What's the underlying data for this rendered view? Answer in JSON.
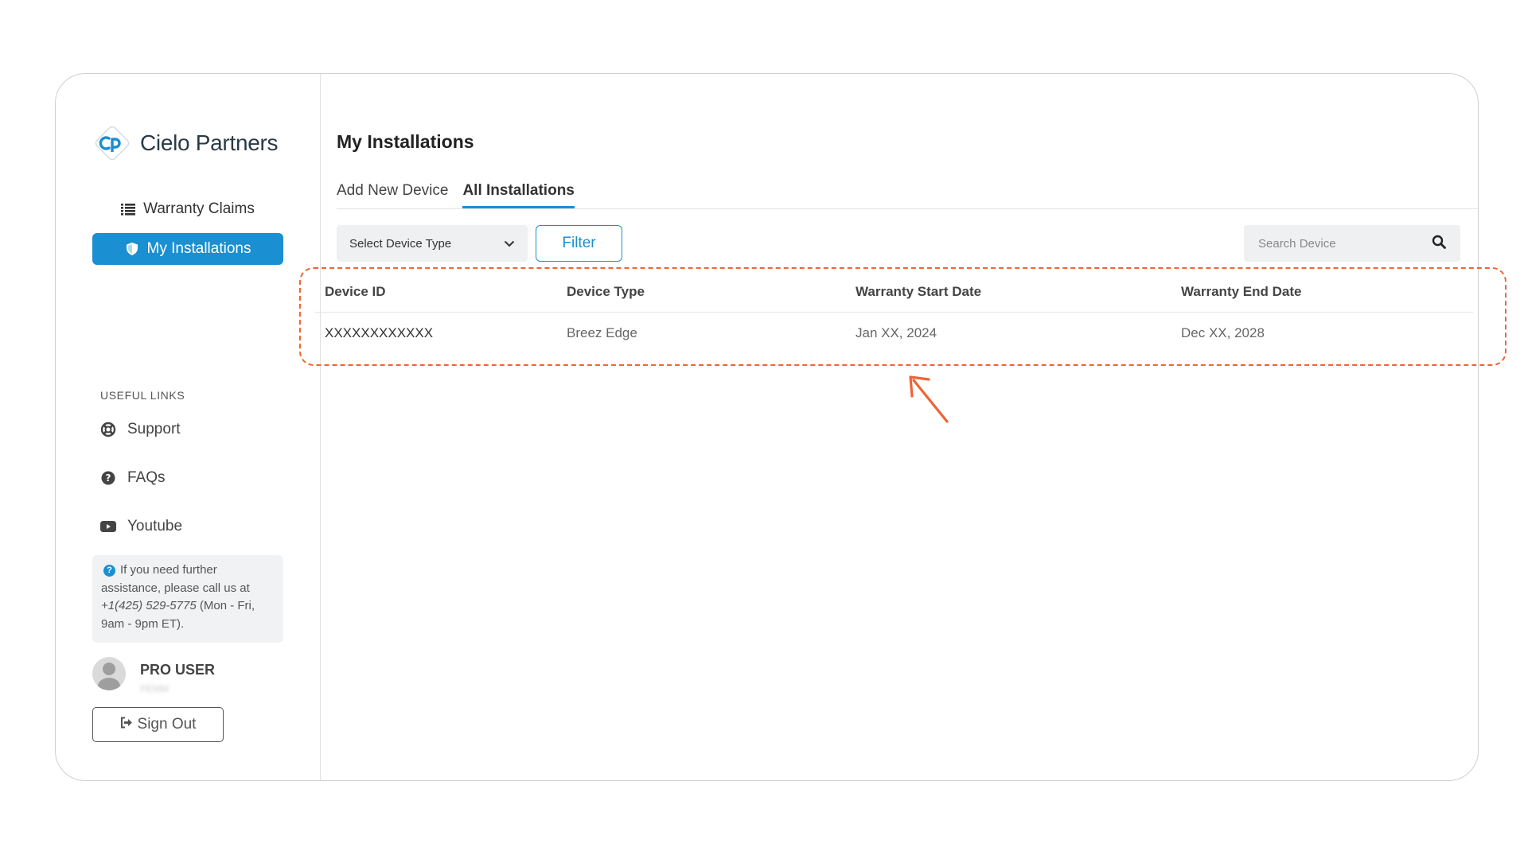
{
  "brand": {
    "name": "Cielo Partners",
    "mark": "cp",
    "color": "#1a8fd1"
  },
  "sidebar": {
    "nav": [
      {
        "label": "Warranty Claims",
        "icon": "list-icon",
        "active": false
      },
      {
        "label": "My Installations",
        "icon": "shield-icon",
        "active": true
      }
    ],
    "useful_links_title": "USEFUL LINKS",
    "links": [
      {
        "label": "Support",
        "icon": "lifebuoy-icon"
      },
      {
        "label": "FAQs",
        "icon": "question-circle-icon"
      },
      {
        "label": "Youtube",
        "icon": "youtube-icon"
      }
    ],
    "help": {
      "text_before": "If you need further assistance, please call us at",
      "phone": "+1(425) 529-5775",
      "text_after": "(Mon - Fri, 9am - 9pm ET)."
    },
    "user": {
      "name": "PRO USER",
      "role": "PEMM"
    },
    "signout_label": "Sign Out"
  },
  "main": {
    "title": "My Installations",
    "tabs": [
      {
        "label": "Add New Device",
        "active": false
      },
      {
        "label": "All Installations",
        "active": true
      }
    ],
    "device_type_select": {
      "value": "Select Device Type"
    },
    "filter_label": "Filter",
    "search": {
      "placeholder": "Search Device"
    },
    "table": {
      "columns": [
        "Device ID",
        "Device Type",
        "Warranty Start Date",
        "Warranty End Date"
      ],
      "rows": [
        [
          "XXXXXXXXXXXX",
          "Breez Edge",
          "Jan XX, 2024",
          "Dec XX, 2028"
        ]
      ]
    }
  },
  "annotation": {
    "color": "#ef6436"
  }
}
